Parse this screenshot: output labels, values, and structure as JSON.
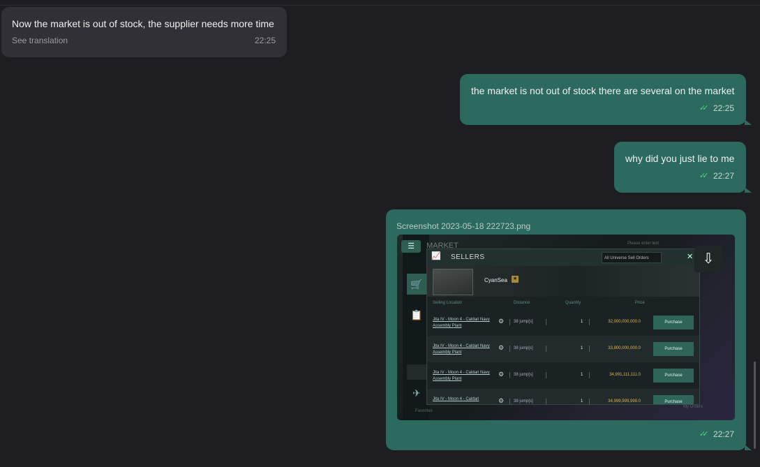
{
  "messages": [
    {
      "direction": "incoming",
      "text": "Now the market is out of stock, the supplier needs more time",
      "translate_link": "See translation",
      "time": "22:25"
    },
    {
      "direction": "outgoing",
      "text": "the market is not out of stock there are several on the market",
      "time": "22:25",
      "read": true
    },
    {
      "direction": "outgoing",
      "text": "why did you just lie to me",
      "time": "22:27",
      "read": true
    },
    {
      "direction": "outgoing",
      "type": "image",
      "file_name": "Screenshot 2023-05-18 222723.png",
      "time": "22:27",
      "read": true,
      "download_icon": "cloud-download-icon",
      "image_content": {
        "app_title": "MARKET",
        "search_placeholder": "Please enter text",
        "panel_title": "SELLERS",
        "filter": "All Universe Sell Orders",
        "item_name": "CyanSea",
        "columns": [
          "Selling Location",
          "Distance",
          "Quantity",
          "Price"
        ],
        "rows": [
          {
            "location": "Jita IV - Moon 4 - Caldari Navy Assembly Plant",
            "distance": "38 jump[s]",
            "quantity": "1",
            "price": "32,000,000,000.0",
            "action": "Purchase"
          },
          {
            "location": "Jita IV - Moon 4 - Caldari Navy Assembly Plant",
            "distance": "38 jump[s]",
            "quantity": "1",
            "price": "33,800,000,000.0",
            "action": "Purchase"
          },
          {
            "location": "Jita IV - Moon 4 - Caldari Navy Assembly Plant",
            "distance": "38 jump[s]",
            "quantity": "1",
            "price": "34,991,111,111.0",
            "action": "Purchase"
          },
          {
            "location": "Jita IV - Moon 4 - Caldari",
            "distance": "38 jump[s]",
            "quantity": "1",
            "price": "34,999,999,999.0",
            "action": "Purchase"
          }
        ],
        "sidebar_bottom_label": "Favorites",
        "footer_label": "My Orders"
      }
    }
  ],
  "colors": {
    "background": "#1e1e22",
    "incoming_bubble": "#303036",
    "outgoing_bubble": "#2b6a5d",
    "read_check": "#5ad28a",
    "price": "#e0b250"
  }
}
